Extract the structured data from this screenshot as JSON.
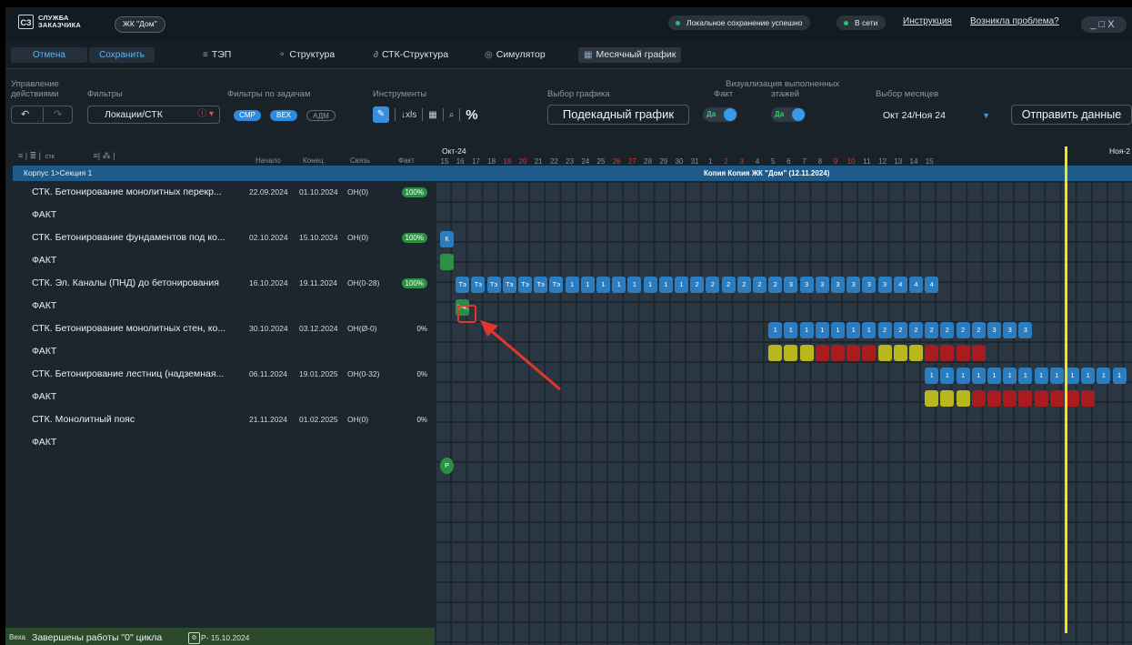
{
  "titlebar": {
    "logo_mark": "СЗ",
    "logo_line1": "СЛУЖБА",
    "logo_line2": "ЗАКАЗЧИКА",
    "project": "ЖК \"Дом\"",
    "status_save": "Локальное сохранение успешно",
    "status_online": "В сети",
    "link_help": "Инструкция",
    "link_problem": "Возникла проблема?",
    "window_controls": "_□X"
  },
  "toolbar1": {
    "cancel": "Отмена",
    "save": "Сохранить",
    "tabs": [
      {
        "label": "ТЭП",
        "icon": "list-icon"
      },
      {
        "label": "Структура",
        "icon": "structure-icon"
      },
      {
        "label": "СТК-Структура",
        "icon": "link-icon"
      },
      {
        "label": "Симулятор",
        "icon": "simulator-icon"
      },
      {
        "label": "Месячный график",
        "icon": "calendar-icon"
      }
    ]
  },
  "toolbar2": {
    "actions_label_1": "Управление",
    "actions_label_2": "действиями",
    "filters_label": "Фильтры",
    "filter_value": "Локации/СТК",
    "task_filters_label": "Фильтры по задачам",
    "chips": [
      "СМР",
      "ВЕХ",
      "АДМ"
    ],
    "tools_label": "Инструменты",
    "xls": "↓xls",
    "percent": "%",
    "graph_choice_label": "Выбор графика",
    "graph_choice_value": "Подекадный график",
    "fact_label": "Факт",
    "fact_toggle": "Да",
    "viz_label_1": "Визуализация выполненных",
    "viz_label_2": "этажей",
    "viz_toggle": "Да",
    "months_label": "Выбор месяцев",
    "months_value": "Окт 24/Ноя 24",
    "send": "Отправить данные"
  },
  "grid": {
    "col_stk": "стк",
    "col_start": "Начало",
    "col_end": "Конец",
    "col_link": "Связь",
    "col_fact": "Факт",
    "month1": "Окт-24",
    "month2": "Ноя-2",
    "days": [
      "15",
      "16",
      "17",
      "18",
      "19",
      "20",
      "21",
      "22",
      "23",
      "24",
      "25",
      "26",
      "27",
      "28",
      "29",
      "30",
      "31",
      "1",
      "2",
      "3",
      "4",
      "5",
      "6",
      "7",
      "8",
      "9",
      "10",
      "11",
      "12",
      "13",
      "14",
      "15"
    ],
    "weekend_days_idx": [
      4,
      5,
      11,
      12,
      18,
      19,
      25,
      26
    ],
    "section_left": "Корпус 1>Секция 1",
    "section_center": "Копия Копия ЖК \"Дом\" (12.11.2024)",
    "rows": [
      {
        "name": "СТК. Бетонирование монолитных перекр...",
        "start": "22.09.2024",
        "end": "01.10.2024",
        "link": "ОН(0)",
        "pct": "100%"
      },
      {
        "name": "ФАКТ"
      },
      {
        "name": "СТК. Бетонирование фундаментов под ко...",
        "start": "02.10.2024",
        "end": "15.10.2024",
        "link": "ОН(0)",
        "pct": "100%"
      },
      {
        "name": "ФАКТ"
      },
      {
        "name": "СТК. Эл. Каналы (ПНД) до бетонирования",
        "start": "16.10.2024",
        "end": "19.11.2024",
        "link": "ОН(0-28)",
        "pct": "100%"
      },
      {
        "name": "ФАКТ"
      },
      {
        "name": "СТК. Бетонирование монолитных стен, ко...",
        "start": "30.10.2024",
        "end": "03.12.2024",
        "link": "ОН(Ø-0)",
        "pct": "0%"
      },
      {
        "name": "ФАКТ"
      },
      {
        "name": "СТК. Бетонирование лестниц (надземная...",
        "start": "06.11.2024",
        "end": "19.01.2025",
        "link": "ОН(0-32)",
        "pct": "0%"
      },
      {
        "name": "ФАКТ"
      },
      {
        "name": "СТК. Монолитный пояс",
        "start": "21.11.2024",
        "end": "01.02.2025",
        "link": "ОН(0)",
        "pct": "0%"
      },
      {
        "name": "ФАКТ"
      }
    ],
    "milestone": {
      "tag": "Веха",
      "name": "Завершены работы \"0\" цикла",
      "date": "Р- 15.10.2024",
      "marker": "Р"
    },
    "cell_k": "К",
    "cell_te": "Тэ",
    "cell_fact_label": "1-4,"
  },
  "colors": {
    "blue": "#2b7dc1",
    "green": "#2c8f43",
    "yellow": "#b8b71c",
    "red": "#a81b1e",
    "today": "#f2e60e",
    "annotation": "#e2362c"
  }
}
